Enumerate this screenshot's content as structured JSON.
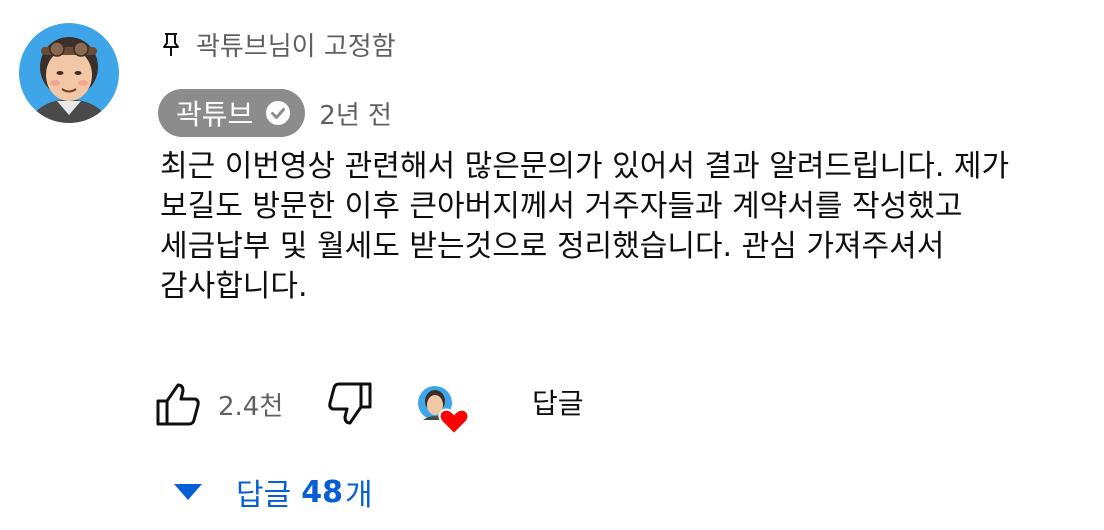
{
  "comment": {
    "avatar_icon": "creator-avatar",
    "pinned_icon": "pin-icon",
    "pinned_text": "곽튜브님이 고정함",
    "author": "곽튜브",
    "verified_icon": "verified-check-icon",
    "time": "2년 전",
    "text": "최근 이번영상 관련해서 많은문의가 있어서 결과 알려드립니다. 제가 보길도 방문한 이후 큰아버지께서 거주자들과 계약서를 작성했고 세금납부 및 월세도 받는것으로 정리했습니다. 관심 가져주셔서 감사합니다."
  },
  "actions": {
    "like_icon": "thumbs-up-icon",
    "like_count": "2.4천",
    "dislike_icon": "thumbs-down-icon",
    "creator_heart_icon": "creator-heart-icon",
    "reply_label": "답글"
  },
  "replies": {
    "toggle_icon": "caret-down-icon",
    "label": "답글",
    "count": "48",
    "unit": "개"
  },
  "colors": {
    "link_blue": "#065fd4",
    "secondary_text": "#606060",
    "author_chip": "#8c8c8c",
    "heart_red": "#ff0000",
    "avatar_bg": "#3ea6e8"
  }
}
